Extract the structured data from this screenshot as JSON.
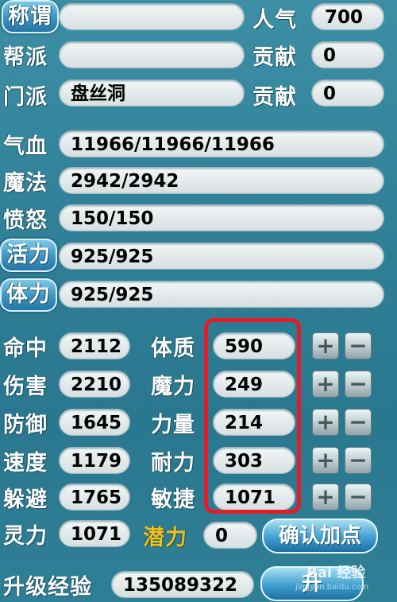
{
  "top": {
    "title_label": "称谓",
    "title_value": "",
    "faction_label": "帮派",
    "faction_value": "",
    "school_label": "门派",
    "school_value": "盘丝洞",
    "popularity_label": "人气",
    "popularity_value": "700",
    "contribution1_label": "贡献",
    "contribution1_value": "0",
    "contribution2_label": "贡献",
    "contribution2_value": "0"
  },
  "stats": {
    "hp_label": "气血",
    "hp_value": "11966/11966/11966",
    "mp_label": "魔法",
    "mp_value": "2942/2942",
    "anger_label": "愤怒",
    "anger_value": "150/150",
    "vitality_label": "活力",
    "vitality_value": "925/925",
    "stamina_label": "体力",
    "stamina_value": "925/925"
  },
  "combat": [
    {
      "label": "命中",
      "value": "2112"
    },
    {
      "label": "伤害",
      "value": "2210"
    },
    {
      "label": "防御",
      "value": "1645"
    },
    {
      "label": "速度",
      "value": "1179"
    },
    {
      "label": "躲避",
      "value": "1765"
    },
    {
      "label": "灵力",
      "value": "1071"
    }
  ],
  "attributes": [
    {
      "label": "体质",
      "value": "590"
    },
    {
      "label": "魔力",
      "value": "249"
    },
    {
      "label": "力量",
      "value": "214"
    },
    {
      "label": "耐力",
      "value": "303"
    },
    {
      "label": "敏捷",
      "value": "1071"
    }
  ],
  "potential": {
    "label": "潜力",
    "value": "0",
    "color": "#f2c21a"
  },
  "confirm_button": "确认加点",
  "exp": {
    "label": "升级经验",
    "value": "135089322"
  },
  "upgrade_button": "升",
  "plus_symbol": "+",
  "minus_symbol": "−",
  "watermark": "Bai 经验",
  "watermark_sub": "jingyan.baidu.com",
  "highlight_color": "#e11d2a"
}
